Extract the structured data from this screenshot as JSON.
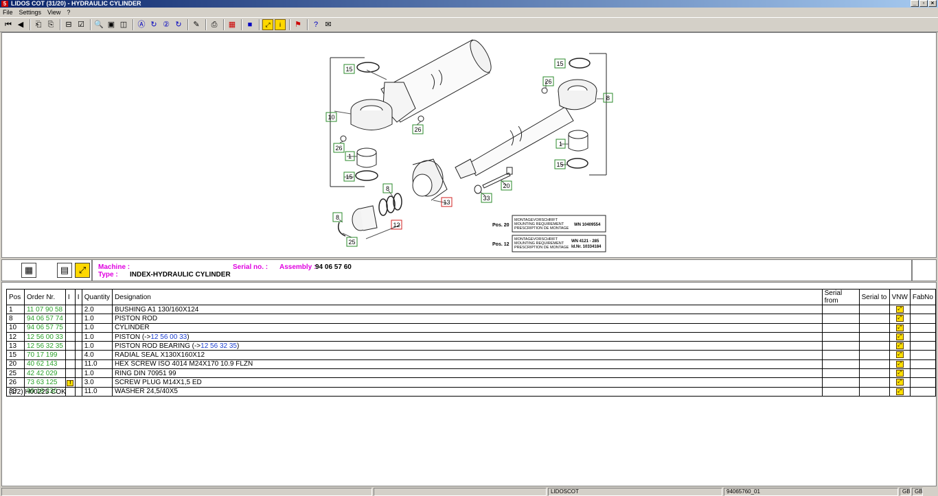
{
  "window": {
    "title": "LIDOS COT (31/20) - HYDRAULIC CYLINDER",
    "icon_text": "5",
    "buttons": [
      "_",
      "▫",
      "×"
    ]
  },
  "menu": {
    "items": [
      "File",
      "Settings",
      "View",
      "?"
    ]
  },
  "drawing": {
    "callouts_green": [
      {
        "id": "15"
      },
      {
        "id": "10"
      },
      {
        "id": "26"
      },
      {
        "id": "26"
      },
      {
        "id": "1"
      },
      {
        "id": "15"
      },
      {
        "id": "8"
      },
      {
        "id": "8"
      },
      {
        "id": "25"
      },
      {
        "id": "33"
      },
      {
        "id": "20"
      },
      {
        "id": "15"
      },
      {
        "id": "26"
      },
      {
        "id": "8"
      },
      {
        "id": "1"
      },
      {
        "id": "15"
      }
    ],
    "callouts_red": [
      "12",
      "13"
    ],
    "mounting_boxes": [
      {
        "pos": "Pos. 20",
        "lines": [
          "MONTAGEVORSCHRIFT",
          "MOUNTING REQUIREMENT",
          "PRESCRIPTION DE MONTAGE"
        ],
        "ref": "WN 10409554",
        "ref2": ""
      },
      {
        "pos": "Pos. 12",
        "lines": [
          "MONTAGEVORSCHRIFT",
          "MOUNTING REQUIREMENT",
          "PRESCRIPTION DE MONTAGE"
        ],
        "ref": "WN 4121 - 285",
        "ref2": "Id.Nr. 10334184"
      }
    ]
  },
  "info": {
    "machine_label": "Machine :",
    "machine_value": "",
    "type_label": "Type :",
    "type_value": "INDEX-HYDRAULIC CYLINDER",
    "serial_label": "Serial no. :",
    "serial_value": "",
    "assembly_label": "Assembly :",
    "assembly_value": "94 06 57 60"
  },
  "table": {
    "headers": [
      "Pos",
      "Order Nr.",
      "I",
      "I",
      "Quantity",
      "Designation",
      "Serial from",
      "Serial to",
      "VNW",
      "FabNo"
    ],
    "rows": [
      {
        "pos": "1",
        "order": "11 07 90 58",
        "note": "",
        "qty": "2.0",
        "designation": "BUSHING A1 130/160X124",
        "ref": ""
      },
      {
        "pos": "8",
        "order": "94 06 57 74",
        "note": "",
        "qty": "1.0",
        "designation": "PISTON ROD",
        "ref": ""
      },
      {
        "pos": "10",
        "order": "94 06 57 75",
        "note": "",
        "qty": "1.0",
        "designation": "CYLINDER",
        "ref": ""
      },
      {
        "pos": "12",
        "order": "12 56 00 33",
        "note": "",
        "qty": "1.0",
        "designation": "PISTON (->",
        "ref": "12 56 00 33",
        "ref_close": ")"
      },
      {
        "pos": "13",
        "order": "12 56 32 35",
        "note": "",
        "qty": "1.0",
        "designation": "PISTON ROD BEARING (->",
        "ref": "12 56 32 35",
        "ref_close": ")"
      },
      {
        "pos": "15",
        "order": "70 17 199",
        "note": "",
        "qty": "4.0",
        "designation": "RADIAL SEAL X130X160X12",
        "ref": ""
      },
      {
        "pos": "20",
        "order": "40 62 143",
        "note": "",
        "qty": "11.0",
        "designation": "HEX SCREW ISO 4014 M24X170 10.9 FLZN",
        "ref": ""
      },
      {
        "pos": "25",
        "order": "42 42 029",
        "note": "",
        "qty": "1.0",
        "designation": "RING DIN 70951 99",
        "ref": ""
      },
      {
        "pos": "26",
        "order": "73 63 125",
        "note": "!",
        "qty": "3.0",
        "designation": "SCREW PLUG M14X1,5 ED",
        "ref": ""
      },
      {
        "pos": "33",
        "order": "99 18 230",
        "note": "",
        "qty": "11.0",
        "designation": "WASHER 24,5/40X5",
        "ref": ""
      }
    ],
    "page_info": "(1/2) H00225 COK"
  },
  "status": {
    "app": "LIDOSCOT",
    "assembly": "94065760_01",
    "lang1": "GB",
    "lang2": "GB"
  },
  "colors": {
    "callout_green": "#2a8a2a",
    "callout_red": "#d02020",
    "order_green": "#2aa12a",
    "label_magenta": "#e000e0",
    "ref_blue": "#1c3fd0"
  }
}
